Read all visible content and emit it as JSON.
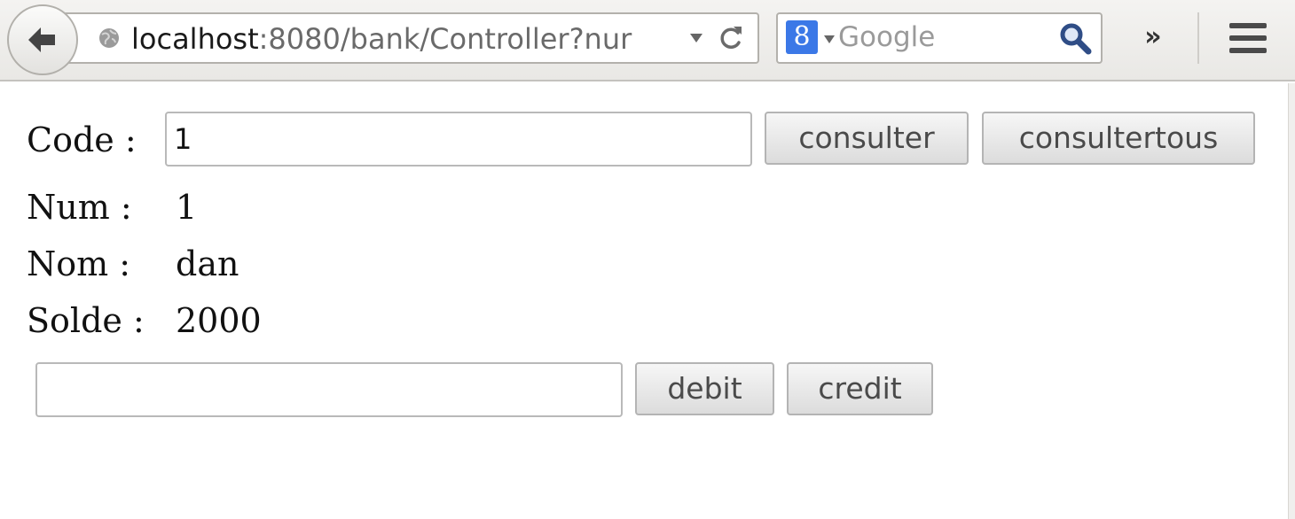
{
  "browser": {
    "url_host": "localhost",
    "url_rest": ":8080/bank/Controller?nur",
    "search_engine_letter": "8",
    "search_placeholder": "Google",
    "overflow_label": "»",
    "icons": {
      "back": "back-arrow-icon",
      "globe": "globe-icon",
      "dropdown": "chevron-down-icon",
      "reload": "reload-icon",
      "engine": "google-engine-icon",
      "search": "search-icon",
      "overflow": "overflow-chevron-icon",
      "menu": "hamburger-menu-icon"
    }
  },
  "form": {
    "code_label": "Code :",
    "code_value": "1",
    "consulter_label": "consulter",
    "consultertous_label": "consultertous"
  },
  "account": {
    "num_label": "Num :",
    "num_value": "1",
    "nom_label": "Nom :",
    "nom_value": "dan",
    "solde_label": "Solde :",
    "solde_value": "2000"
  },
  "operation": {
    "amount_value": "",
    "debit_label": "debit",
    "credit_label": "credit"
  }
}
